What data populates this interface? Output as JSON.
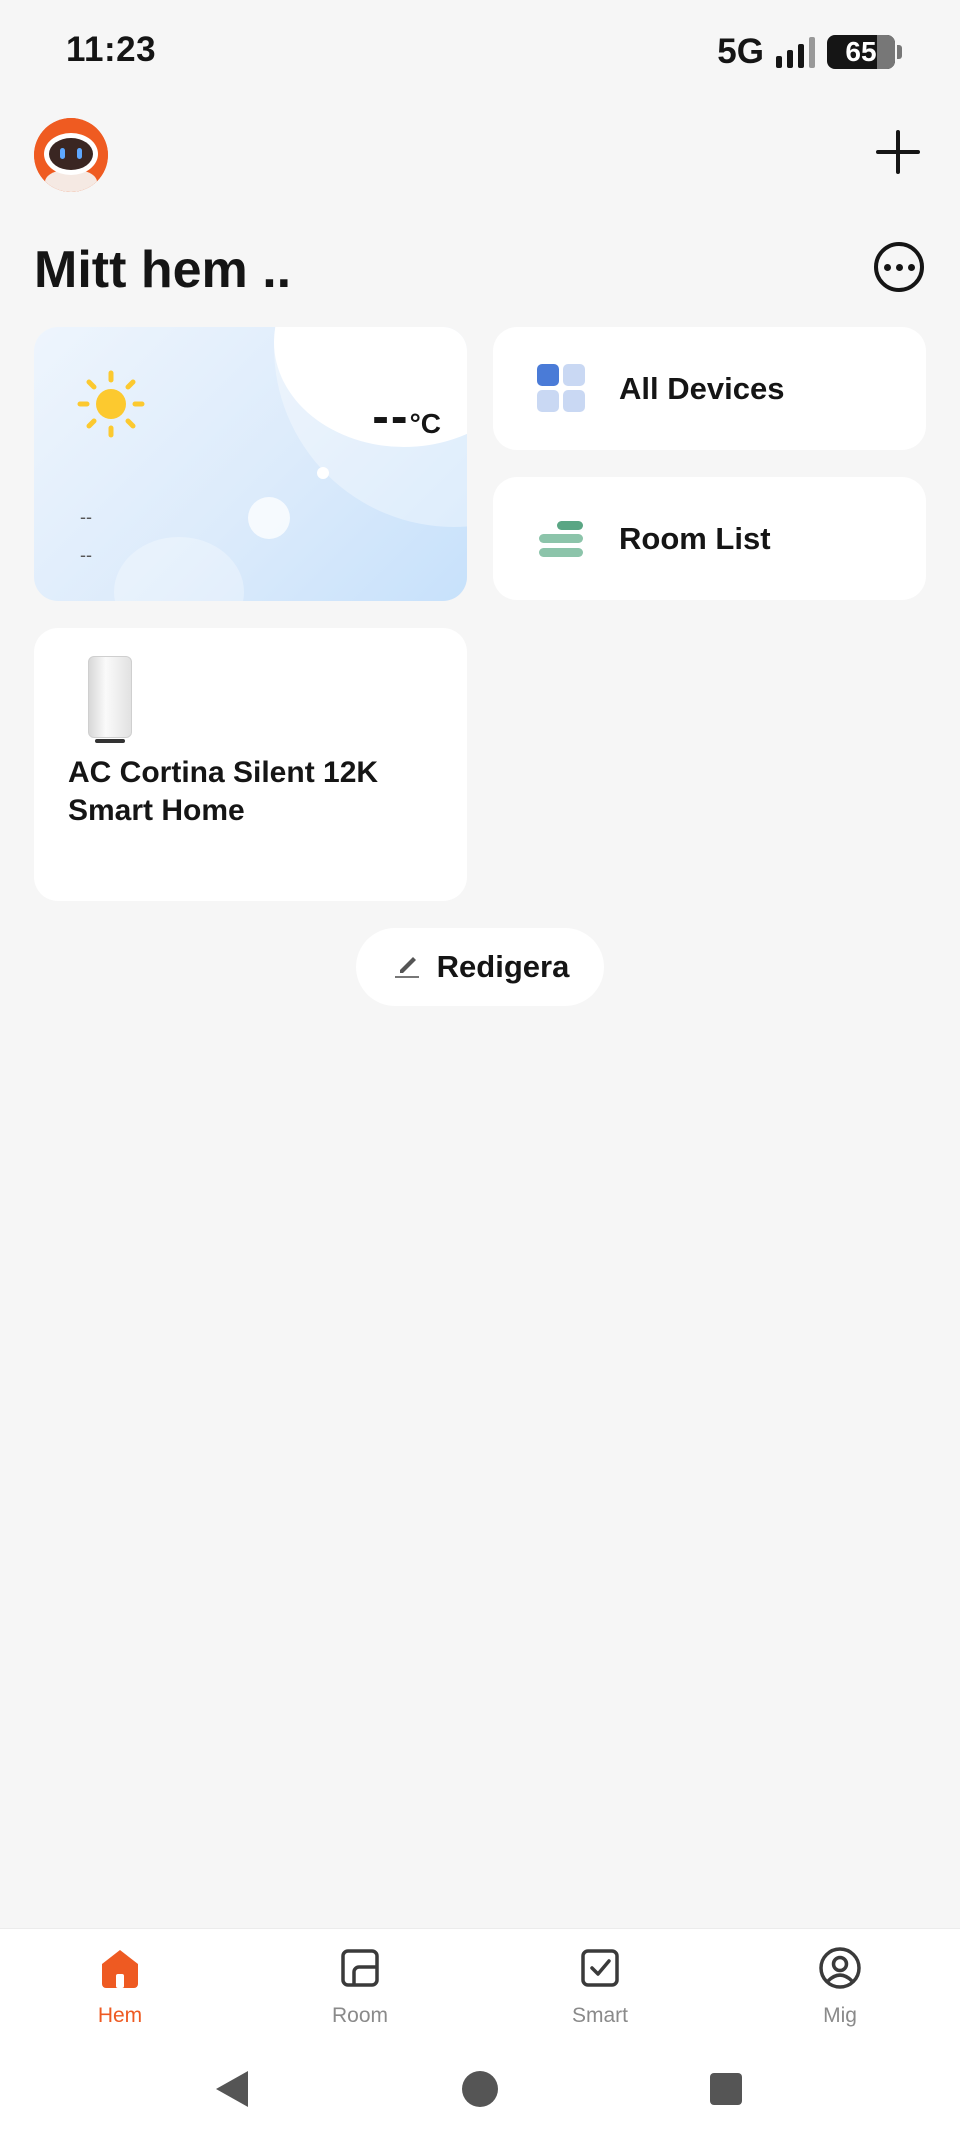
{
  "status_bar": {
    "time": "11:23",
    "network": "5G",
    "battery": "65"
  },
  "header": {
    "home_title": "Mitt hem .."
  },
  "weather": {
    "temperature": "--",
    "unit": "°C",
    "line1": "--",
    "line2": "--"
  },
  "quick_actions": {
    "all_devices": "All Devices",
    "room_list": "Room List"
  },
  "devices": [
    {
      "name": "AC Cortina Silent 12K Smart Home"
    }
  ],
  "edit_button": {
    "label": "Redigera"
  },
  "tabs": [
    {
      "label": "Hem",
      "icon": "home-icon",
      "active": true
    },
    {
      "label": "Room",
      "icon": "room-icon",
      "active": false
    },
    {
      "label": "Smart",
      "icon": "smart-icon",
      "active": false
    },
    {
      "label": "Mig",
      "icon": "profile-icon",
      "active": false
    }
  ],
  "colors": {
    "accent": "#ee5a22",
    "background": "#f6f6f6",
    "card": "#ffffff"
  }
}
